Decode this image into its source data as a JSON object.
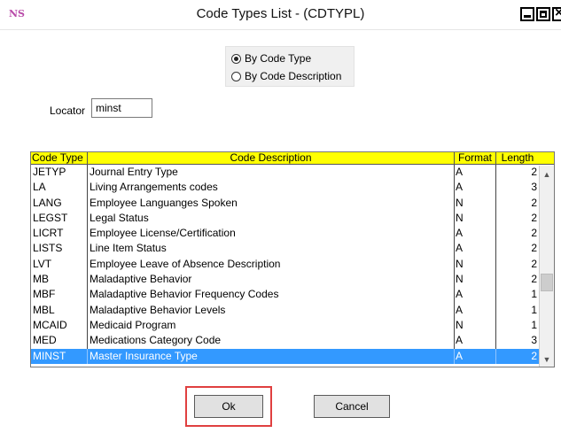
{
  "window": {
    "title": "Code Types List - (CDTYPL)",
    "logo": "NS"
  },
  "sort_options": [
    {
      "label": "By Code Type",
      "checked": true
    },
    {
      "label": "By Code Description",
      "checked": false
    }
  ],
  "locator": {
    "label": "Locator",
    "value": "minst"
  },
  "table": {
    "headers": [
      "Code Type",
      "Code Description",
      "Format",
      "Length"
    ],
    "rows": [
      {
        "code": "JETYP",
        "desc": "Journal Entry Type",
        "format": "A",
        "length": "2"
      },
      {
        "code": "LA",
        "desc": "Living Arrangements codes",
        "format": "A",
        "length": "3"
      },
      {
        "code": "LANG",
        "desc": "Employee Languanges Spoken",
        "format": "N",
        "length": "2"
      },
      {
        "code": "LEGST",
        "desc": "Legal Status",
        "format": "N",
        "length": "2"
      },
      {
        "code": "LICRT",
        "desc": "Employee License/Certification",
        "format": "A",
        "length": "2"
      },
      {
        "code": "LISTS",
        "desc": "Line Item Status",
        "format": "A",
        "length": "2"
      },
      {
        "code": "LVT",
        "desc": "Employee Leave of Absence Description",
        "format": "N",
        "length": "2"
      },
      {
        "code": "MB",
        "desc": "Maladaptive Behavior",
        "format": "N",
        "length": "2"
      },
      {
        "code": "MBF",
        "desc": "Maladaptive Behavior Frequency Codes",
        "format": "A",
        "length": "1"
      },
      {
        "code": "MBL",
        "desc": "Maladaptive Behavior Levels",
        "format": "A",
        "length": "1"
      },
      {
        "code": "MCAID",
        "desc": "Medicaid Program",
        "format": "N",
        "length": "1"
      },
      {
        "code": "MED",
        "desc": "Medications Category Code",
        "format": "A",
        "length": "3"
      },
      {
        "code": "MINST",
        "desc": "Master Insurance Type",
        "format": "A",
        "length": "2",
        "selected": true
      }
    ]
  },
  "buttons": {
    "ok": "Ok",
    "cancel": "Cancel"
  },
  "colors": {
    "header_bg": "#ffff00",
    "selection": "#3399ff",
    "highlight_box": "#e04040"
  }
}
